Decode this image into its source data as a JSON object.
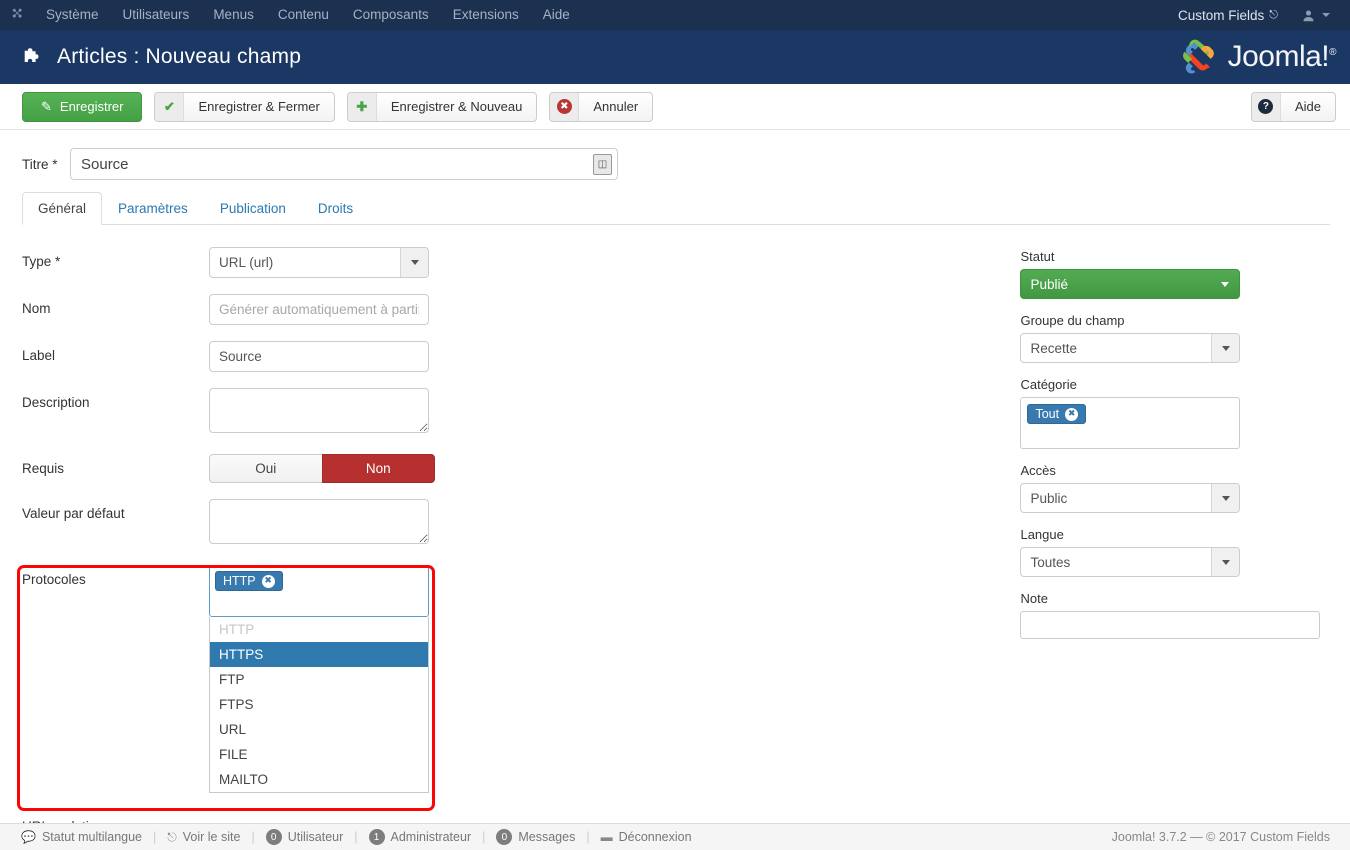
{
  "adminbar": {
    "brand_icon": "joomla-logo-icon",
    "menu": [
      {
        "label": "Système"
      },
      {
        "label": "Utilisateurs"
      },
      {
        "label": "Menus"
      },
      {
        "label": "Contenu"
      },
      {
        "label": "Composants"
      },
      {
        "label": "Extensions"
      },
      {
        "label": "Aide"
      }
    ],
    "site_name": "Custom Fields",
    "site_name_icon": "external-link-icon",
    "user_icon": "user-icon"
  },
  "header": {
    "page_icon": "puzzle-piece-icon",
    "title": "Articles : Nouveau champ",
    "logo_text": "Joomla!",
    "logo_tm": "®"
  },
  "toolbar": {
    "save_label": "Enregistrer",
    "save_icon": "pencil-square-icon",
    "save_close_label": "Enregistrer & Fermer",
    "save_close_icon": "check-icon",
    "save_new_label": "Enregistrer & Nouveau",
    "save_new_icon": "plus-icon",
    "cancel_label": "Annuler",
    "cancel_icon": "cancel-circle-icon",
    "help_label": "Aide",
    "help_icon": "question-circle-icon"
  },
  "title_field": {
    "label": "Titre",
    "required_mark": "*",
    "value": "Source",
    "modal_icon": "article-select-icon"
  },
  "tabs": [
    {
      "label": "Général",
      "active": true
    },
    {
      "label": "Paramètres",
      "active": false
    },
    {
      "label": "Publication",
      "active": false
    },
    {
      "label": "Droits",
      "active": false
    }
  ],
  "form": {
    "type": {
      "label": "Type",
      "required_mark": "*",
      "value": "URL (url)"
    },
    "name": {
      "label": "Nom",
      "value": "",
      "placeholder": "Générer automatiquement à partir d"
    },
    "field_label": {
      "label": "Label",
      "value": "Source"
    },
    "description": {
      "label": "Description",
      "value": ""
    },
    "required": {
      "label": "Requis",
      "yes_label": "Oui",
      "no_label": "Non",
      "selected": "Non"
    },
    "default_value": {
      "label": "Valeur par défaut",
      "value": ""
    },
    "protocols": {
      "label": "Protocoles",
      "selected": [
        {
          "label": "HTTP",
          "remove_icon": "remove-chip-icon"
        }
      ],
      "options": [
        {
          "label": "HTTP",
          "state": "disabled"
        },
        {
          "label": "HTTPS",
          "state": "highlighted"
        },
        {
          "label": "FTP",
          "state": "normal"
        },
        {
          "label": "FTPS",
          "state": "normal"
        },
        {
          "label": "URL",
          "state": "normal"
        },
        {
          "label": "FILE",
          "state": "normal"
        },
        {
          "label": "MAILTO",
          "state": "normal"
        }
      ]
    },
    "relative_urls": {
      "label": "URLs relatives"
    }
  },
  "sidebar": {
    "status": {
      "label": "Statut",
      "value": "Publié"
    },
    "field_group": {
      "label": "Groupe du champ",
      "value": "Recette"
    },
    "category": {
      "label": "Catégorie",
      "chips": [
        {
          "label": "Tout",
          "remove_icon": "remove-chip-icon"
        }
      ]
    },
    "access": {
      "label": "Accès",
      "value": "Public"
    },
    "language": {
      "label": "Langue",
      "value": "Toutes"
    },
    "note": {
      "label": "Note",
      "value": ""
    }
  },
  "statusbar": {
    "items": [
      {
        "label": "Statut multilangue",
        "icon": "comment-icon",
        "badge": null
      },
      {
        "label": "Voir le site",
        "icon": "external-link-icon",
        "badge": null
      },
      {
        "label": "Utilisateur",
        "icon": null,
        "badge": "0"
      },
      {
        "label": "Administrateur",
        "icon": null,
        "badge": "1"
      },
      {
        "label": "Messages",
        "icon": null,
        "badge": "0"
      },
      {
        "label": "Déconnexion",
        "icon": "minus-icon",
        "badge": null
      }
    ],
    "copyright": "Joomla! 3.7.2  —  © 2017 Custom Fields"
  },
  "colors": {
    "adminbar_bg": "#1c3050",
    "titlebar_bg": "#1b3763",
    "primary_green": "#4aa24a",
    "danger_red": "#b5302f",
    "chip_blue": "#3879b0",
    "highlight_blue": "#3079ae",
    "highlight_border_red": "#fb0505",
    "link_blue": "#2a7ab0"
  }
}
